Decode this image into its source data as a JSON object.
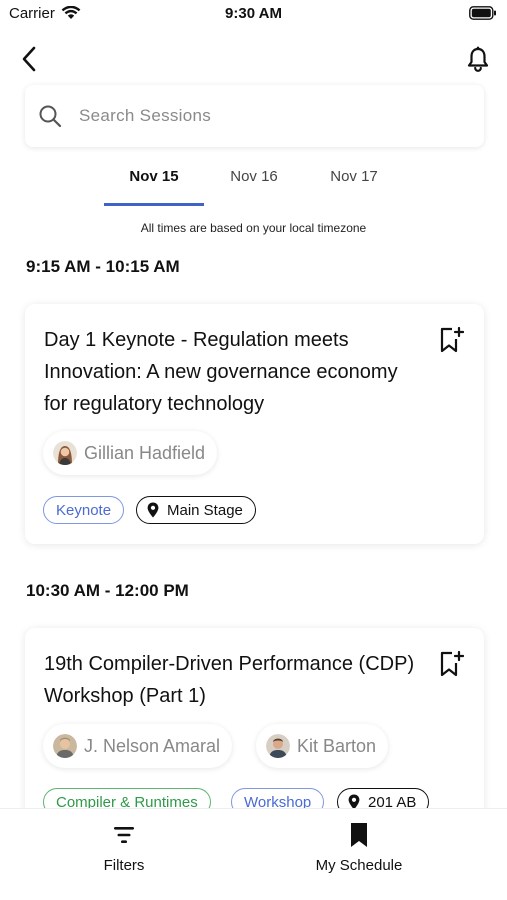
{
  "status_bar": {
    "carrier": "Carrier",
    "time": "9:30 AM"
  },
  "search": {
    "placeholder": "Search Sessions"
  },
  "date_tabs": [
    {
      "label": "Nov 15",
      "active": true
    },
    {
      "label": "Nov 16",
      "active": false
    },
    {
      "label": "Nov 17",
      "active": false
    }
  ],
  "timezone_note": "All times are based on your local timezone",
  "sessions": [
    {
      "time_slot": "9:15 AM - 10:15 AM",
      "title": "Day 1 Keynote - Regulation meets Innovation: A new governance economy for regulatory technology",
      "speakers": [
        "Gillian Hadfield"
      ],
      "tags": [
        "Keynote"
      ],
      "location": "Main Stage"
    },
    {
      "time_slot": "10:30 AM - 12:00 PM",
      "title": "19th Compiler-Driven Performance (CDP) Workshop (Part 1)",
      "speakers": [
        "J. Nelson Amaral",
        "Kit Barton"
      ],
      "tags": [
        "Compiler & Runtimes",
        "Workshop"
      ],
      "location": "201 AB"
    }
  ],
  "bottom_nav": {
    "filters": "Filters",
    "my_schedule": "My Schedule"
  },
  "colors": {
    "accent": "#3f63c9",
    "tag_blue": "#4a6bd4",
    "tag_green": "#2f9a4a"
  },
  "icons": [
    "wifi-icon",
    "battery-icon",
    "back-arrow-icon",
    "bell-icon",
    "search-icon",
    "bookmark-add-icon",
    "location-pin-icon",
    "filter-icon",
    "bookmark-icon"
  ]
}
